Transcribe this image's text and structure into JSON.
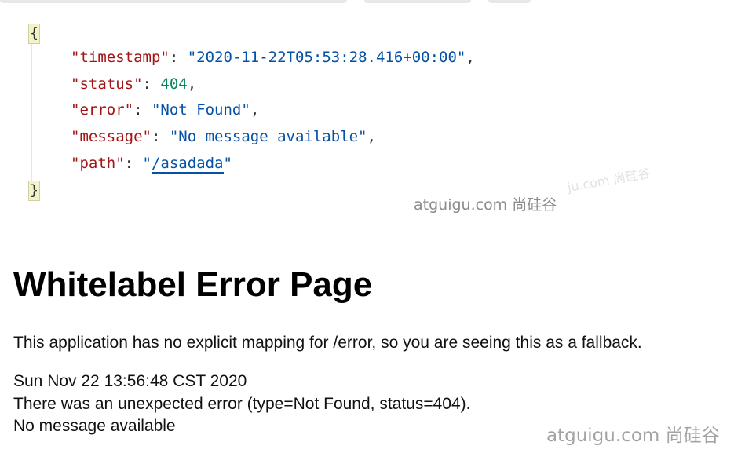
{
  "json_response": {
    "open_brace": "{",
    "close_brace": "}",
    "lines": [
      {
        "key": "\"timestamp\"",
        "sep": ": ",
        "value": "\"2020-11-22T05:53:28.416+00:00\"",
        "end": ","
      },
      {
        "key": "\"status\"",
        "sep": ": ",
        "value": "404",
        "end": ","
      },
      {
        "key": "\"error\"",
        "sep": ": ",
        "value": "\"Not Found\"",
        "end": ","
      },
      {
        "key": "\"message\"",
        "sep": ": ",
        "value": "\"No message available\"",
        "end": ","
      },
      {
        "key": "\"path\"",
        "sep": ": ",
        "value_open_quote": "\"",
        "value_link": "/asadada",
        "value_close_quote": "\""
      }
    ]
  },
  "watermarks": {
    "mid": "atguigu.com 尚硅谷",
    "faint": "ju.com 尚硅谷",
    "bottom": "atguigu.com 尚硅谷"
  },
  "error_page": {
    "title": "Whitelabel Error Page",
    "description": "This application has no explicit mapping for /error, so you are seeing this as a fallback.",
    "timestamp": "Sun Nov 22 13:56:48 CST 2020",
    "error_details": "There was an unexpected error (type=Not Found, status=404).",
    "message": "No message available"
  },
  "colors": {
    "json_key": "#a31515",
    "json_string": "#0451a5",
    "json_number": "#098658",
    "watermark": "#9a9a9a"
  }
}
